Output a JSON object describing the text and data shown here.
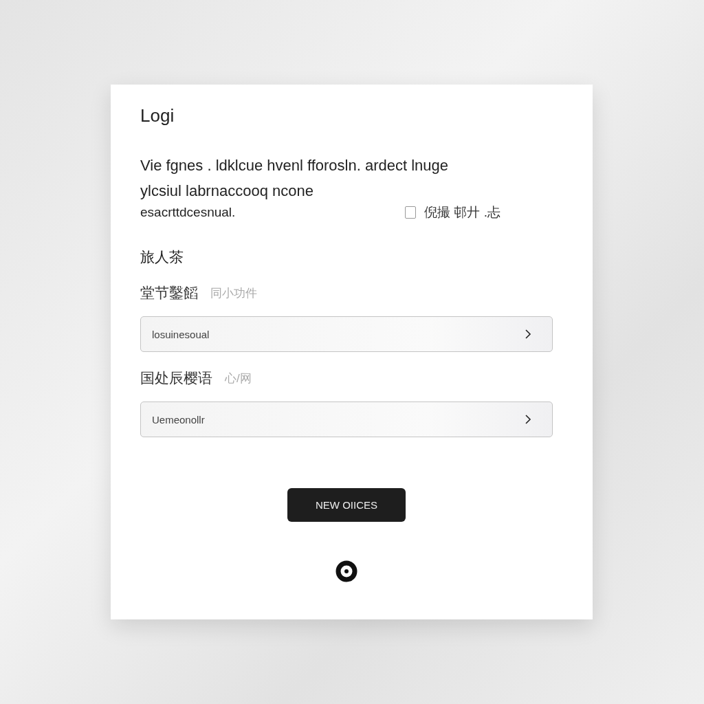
{
  "card": {
    "title": "Logi",
    "description_lines": [
      "Vie fgnes . ldklcue hvenl fforosln. ardect lnuge",
      "ylcsiul labrnaccooq ncone",
      "esacrttdcesnual."
    ],
    "checkbox": {
      "label": "倪撮 邨廾 .忐",
      "checked": false
    },
    "section_title": "旅人茶",
    "fields": [
      {
        "label": "堂节鑿饀",
        "hint": "同小功件",
        "value": "losuinesoual"
      },
      {
        "label": "国处辰樱语",
        "hint": "心/网",
        "value": "Uemeonollr"
      }
    ],
    "button": "NEW OIICES"
  }
}
